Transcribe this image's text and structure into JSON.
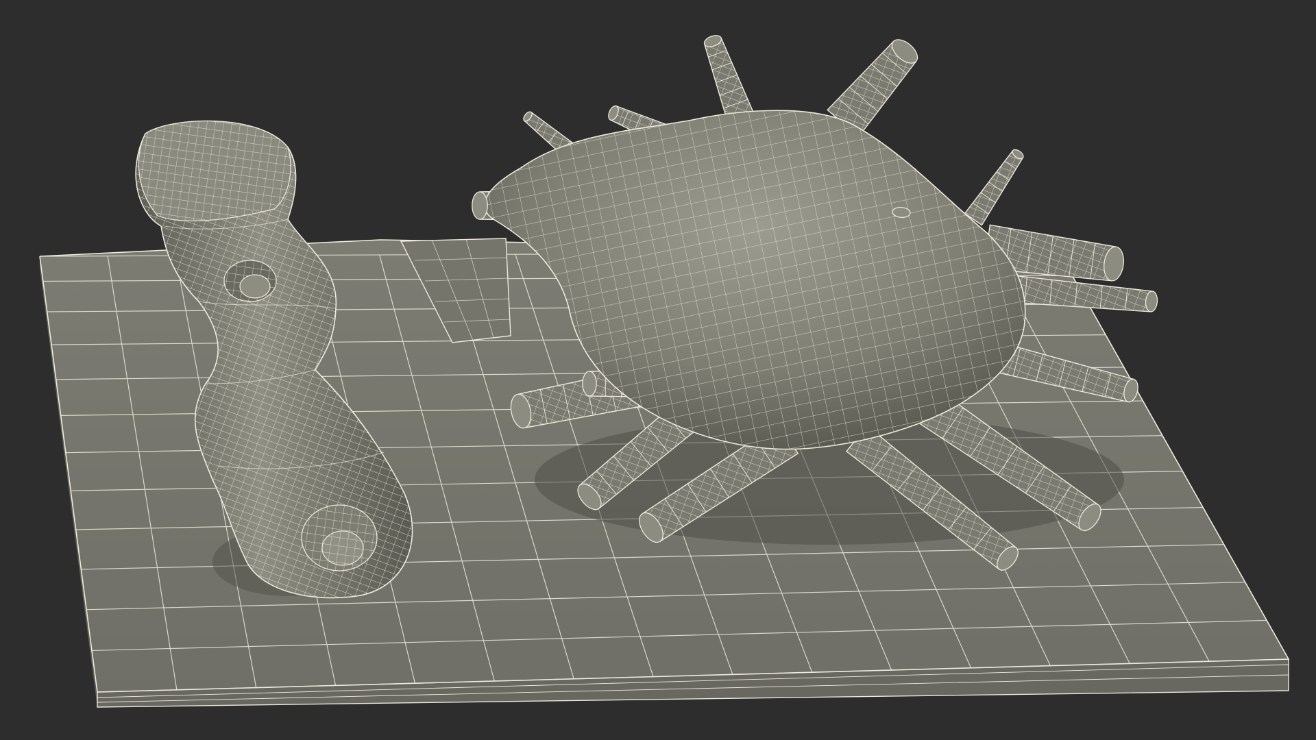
{
  "scene": {
    "subject": "wireframe-3d-model",
    "colors": {
      "background": "#2d2d2d",
      "surface": "#7f7f74",
      "surface_shadow": "#56564e",
      "surface_light": "#9a9a8e",
      "wire": "#eeeadc",
      "base_top": "#797970",
      "base_edge": "#6a6a62"
    }
  }
}
